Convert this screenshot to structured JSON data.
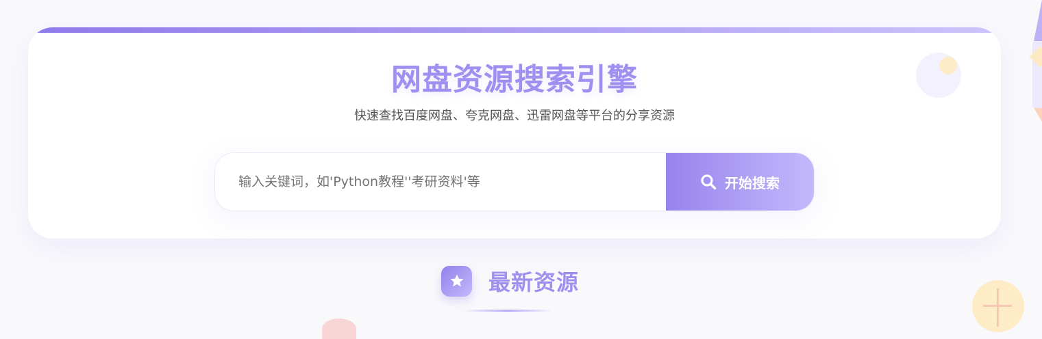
{
  "hero": {
    "title": "网盘资源搜索引擎",
    "subtitle": "快速查找百度网盘、夸克网盘、迅雷网盘等平台的分享资源"
  },
  "search": {
    "value": "",
    "placeholder": "输入关键词，如'Python教程''考研资料'等",
    "button_label": "开始搜索",
    "button_icon": "search-icon"
  },
  "latest": {
    "title": "最新资源",
    "icon": "star-icon"
  },
  "colors": {
    "accent": "#9683ec",
    "accent_light": "#c4b8fb",
    "title": "#a08ff0"
  }
}
